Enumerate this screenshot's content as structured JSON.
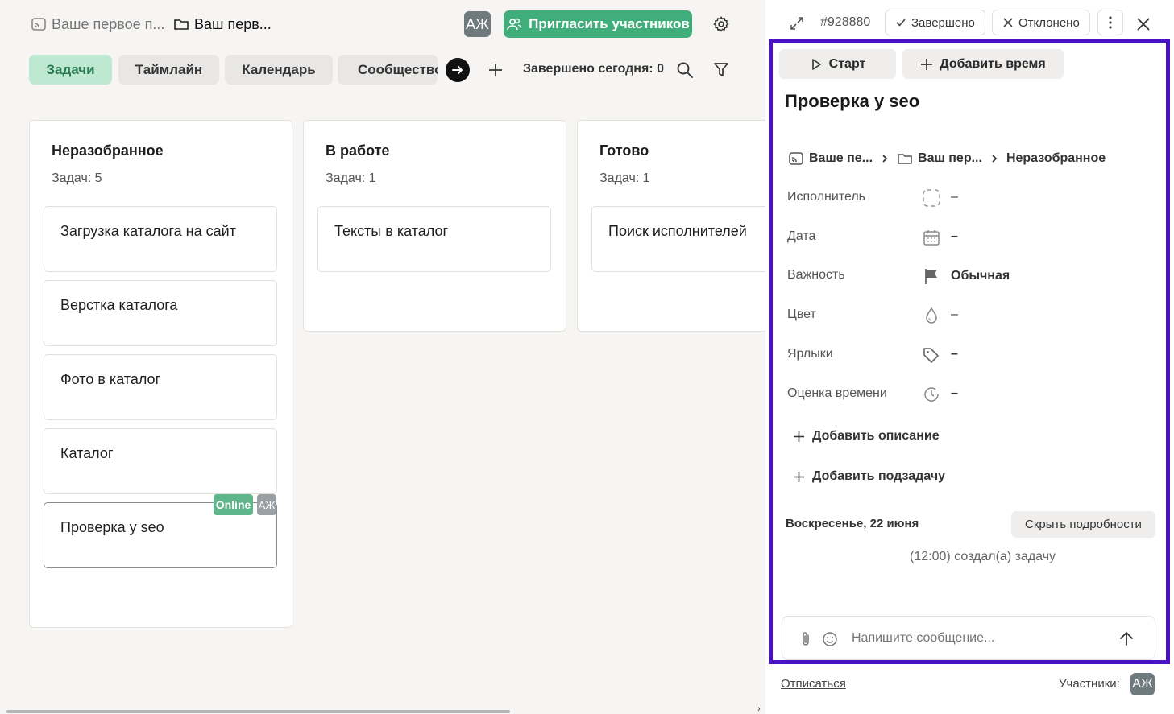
{
  "breadcrumb": {
    "space": "Ваше первое п...",
    "project": "Ваш перв..."
  },
  "user_initials": "АЖ",
  "invite_label": "Пригласить участников",
  "tabs": [
    {
      "label": "Задачи",
      "active": true
    },
    {
      "label": "Таймлайн",
      "active": false
    },
    {
      "label": "Календарь",
      "active": false
    },
    {
      "label": "Сообщество",
      "active": false
    }
  ],
  "completed_today": "Завершено сегодня: 0",
  "columns": [
    {
      "title": "Неразобранное",
      "count": "Задач: 5",
      "cards": [
        "Загрузка каталога на сайт",
        "Верстка каталога",
        "Фото в каталог",
        "Каталог",
        "Проверка у seo"
      ]
    },
    {
      "title": "В работе",
      "count": "Задач: 1",
      "cards": [
        "Тексты в каталог"
      ]
    },
    {
      "title": "Готово",
      "count": "Задач: 1",
      "cards": [
        "Поиск исполнителей"
      ]
    }
  ],
  "card_badges": {
    "online": "Online",
    "initials": "АЖ"
  },
  "task": {
    "id": "#928880",
    "done_label": "Завершено",
    "rejected_label": "Отклонено",
    "start_label": "Старт",
    "add_time_label": "Добавить время",
    "title": "Проверка у seo",
    "path": {
      "space": "Ваше пе...",
      "project": "Ваш пер...",
      "column": "Неразобранное"
    },
    "props": [
      {
        "label": "Исполнитель",
        "value": "–",
        "icon": "assignee-icon"
      },
      {
        "label": "Дата",
        "value": "–",
        "icon": "calendar-icon"
      },
      {
        "label": "Важность",
        "value": "Обычная",
        "icon": "flag-icon"
      },
      {
        "label": "Цвет",
        "value": "–",
        "icon": "color-drop-icon"
      },
      {
        "label": "Ярлыки",
        "value": "–",
        "icon": "tag-icon"
      },
      {
        "label": "Оценка времени",
        "value": "–",
        "icon": "clock-icon"
      }
    ],
    "add_description": "Добавить описание",
    "add_subtask": "Добавить подзадачу",
    "activity_date": "Воскресенье, 22 июня",
    "hide_details": "Скрыть подробности",
    "activity_entry": "(12:00) создал(а) задачу",
    "message_placeholder": "Напишите сообщение...",
    "unsubscribe": "Отписаться",
    "participants_label": "Участники:"
  },
  "colors": {
    "accent_green": "#3fae7a",
    "tab_active": "#bfe8d2",
    "focus_frame": "#4a12c4"
  }
}
